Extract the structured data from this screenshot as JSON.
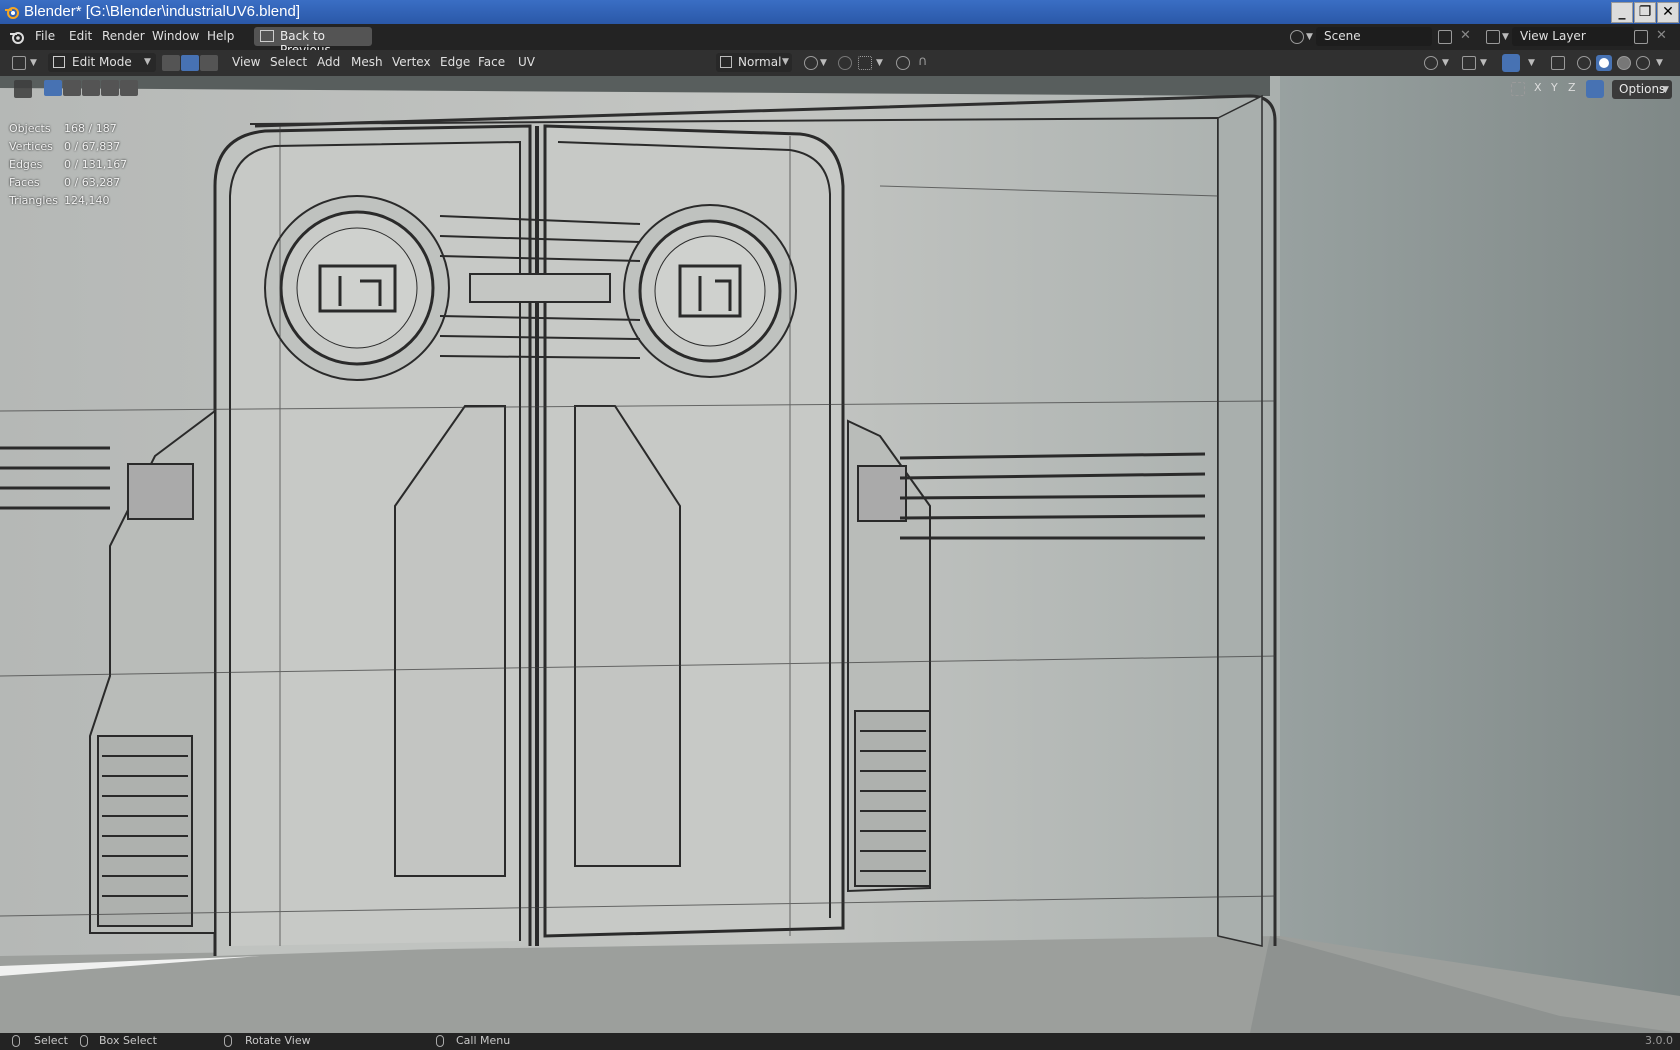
{
  "window": {
    "title": "Blender* [G:\\Blender\\industrialUV6.blend]",
    "controls": [
      "minimize",
      "restore",
      "close"
    ]
  },
  "menubar": {
    "items": [
      "File",
      "Edit",
      "Render",
      "Window",
      "Help"
    ],
    "back_button": "Back to Previous",
    "scene_label": "Scene",
    "view_layer_label": "View Layer"
  },
  "header": {
    "mode": "Edit Mode",
    "menus": [
      "View",
      "Select",
      "Add",
      "Mesh",
      "Vertex",
      "Edge",
      "Face",
      "UV"
    ],
    "orientation": "Normal",
    "select_mode_active": "edge"
  },
  "viewport": {
    "stats": [
      {
        "label": "Objects",
        "value": "168 / 187"
      },
      {
        "label": "Vertices",
        "value": "0 / 67,837"
      },
      {
        "label": "Edges",
        "value": "0 / 131,167"
      },
      {
        "label": "Faces",
        "value": "0 / 63,287"
      },
      {
        "label": "Triangles",
        "value": "124,140"
      }
    ],
    "axes": [
      "X",
      "Y",
      "Z"
    ],
    "options_label": "Options",
    "shading_active": "solid"
  },
  "statusbar": {
    "select": "Select",
    "box_select": "Box Select",
    "rotate": "Rotate View",
    "call_menu": "Call Menu",
    "version": "3.0.0"
  },
  "colors": {
    "titlebar": "#2f62b6",
    "menubar": "#232323",
    "header": "#303030",
    "accent": "#4772b3",
    "viewport_bg": "#8a9493"
  }
}
